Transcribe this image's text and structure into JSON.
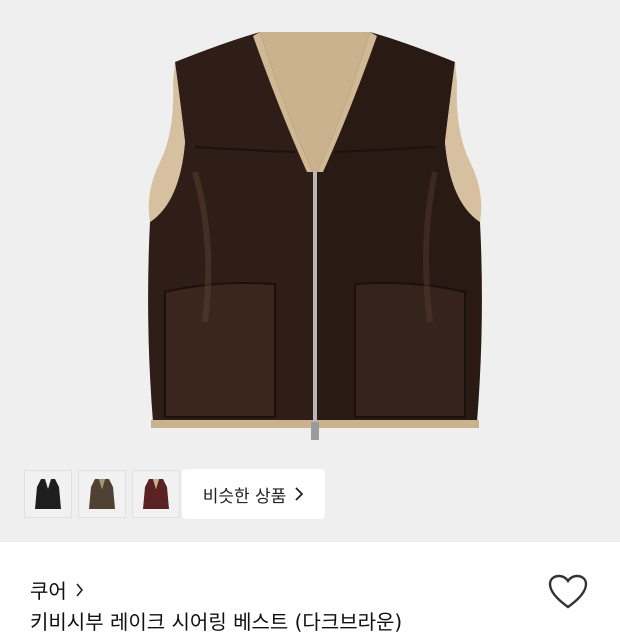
{
  "similar_products": {
    "label": "비슷한 상품"
  },
  "brand": {
    "name": "쿠어"
  },
  "product": {
    "title": "키비시부 레이크 시어링 베스트 (다크브라운)"
  },
  "thumbnails": [
    {
      "name": "black",
      "color": "#1e1e1e"
    },
    {
      "name": "olive-brown",
      "color": "#5a4a3a"
    },
    {
      "name": "burgundy",
      "color": "#5a2222"
    }
  ],
  "icons": {
    "similar_chevron": "chevron-right-icon",
    "brand_chevron": "chevron-right-icon",
    "wishlist": "heart-outline-icon"
  },
  "colors": {
    "background": "#efefef",
    "vest_leather": "#2e1d16",
    "lining": "#c9b08d",
    "text": "#111111"
  }
}
